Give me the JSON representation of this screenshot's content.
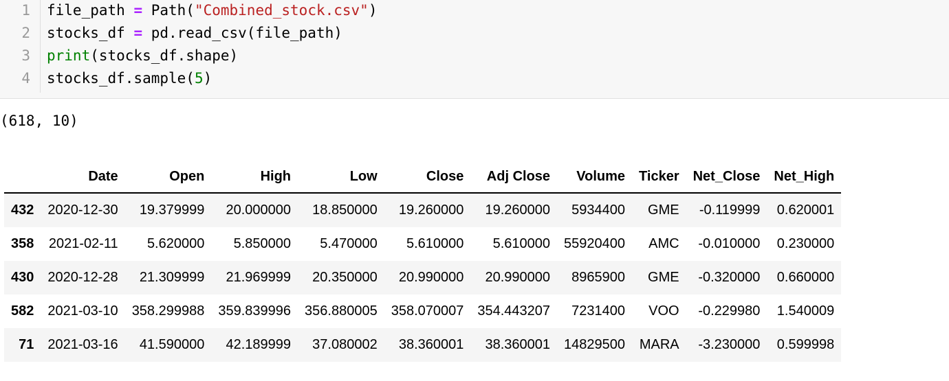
{
  "code_cell": {
    "lines": [
      {
        "number": "1",
        "parts": [
          {
            "text": "file_path ",
            "cls": ""
          },
          {
            "text": "=",
            "cls": "op"
          },
          {
            "text": " Path(",
            "cls": ""
          },
          {
            "text": "\"Combined_stock.csv\"",
            "cls": "str"
          },
          {
            "text": ")",
            "cls": ""
          }
        ]
      },
      {
        "number": "2",
        "parts": [
          {
            "text": "stocks_df ",
            "cls": ""
          },
          {
            "text": "=",
            "cls": "op"
          },
          {
            "text": " pd.read_csv(file_path)",
            "cls": ""
          }
        ]
      },
      {
        "number": "3",
        "parts": [
          {
            "text": "print",
            "cls": "kw"
          },
          {
            "text": "(stocks_df.shape)",
            "cls": ""
          }
        ]
      },
      {
        "number": "4",
        "parts": [
          {
            "text": "stocks_df.sample(",
            "cls": ""
          },
          {
            "text": "5",
            "cls": "num"
          },
          {
            "text": ")",
            "cls": ""
          }
        ]
      }
    ]
  },
  "output": {
    "stdout": "(618, 10)",
    "table": {
      "columns": [
        "",
        "Date",
        "Open",
        "High",
        "Low",
        "Close",
        "Adj Close",
        "Volume",
        "Ticker",
        "Net_Close",
        "Net_High"
      ],
      "rows": [
        [
          "432",
          "2020-12-30",
          "19.379999",
          "20.000000",
          "18.850000",
          "19.260000",
          "19.260000",
          "5934400",
          "GME",
          "-0.119999",
          "0.620001"
        ],
        [
          "358",
          "2021-02-11",
          "5.620000",
          "5.850000",
          "5.470000",
          "5.610000",
          "5.610000",
          "55920400",
          "AMC",
          "-0.010000",
          "0.230000"
        ],
        [
          "430",
          "2020-12-28",
          "21.309999",
          "21.969999",
          "20.350000",
          "20.990000",
          "20.990000",
          "8965900",
          "GME",
          "-0.320000",
          "0.660000"
        ],
        [
          "582",
          "2021-03-10",
          "358.299988",
          "359.839996",
          "356.880005",
          "358.070007",
          "354.443207",
          "7231400",
          "VOO",
          "-0.229980",
          "1.540009"
        ],
        [
          "71",
          "2021-03-16",
          "41.590000",
          "42.189999",
          "37.080002",
          "38.360001",
          "38.360001",
          "14829500",
          "MARA",
          "-3.230000",
          "0.599998"
        ]
      ]
    }
  }
}
